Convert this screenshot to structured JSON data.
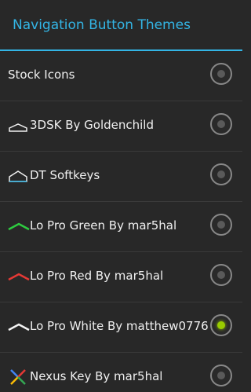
{
  "dialog": {
    "title": "Navigation Button Themes",
    "accent_color": "#33b5e5",
    "selected_color": "#99cc00"
  },
  "options": [
    {
      "label": "Stock Icons",
      "icon": "none",
      "selected": false
    },
    {
      "label": "3DSK By Goldenchild",
      "icon": "home-outline-icon",
      "selected": false
    },
    {
      "label": "DT Softkeys",
      "icon": "home-outline-blue-icon",
      "selected": false
    },
    {
      "label": "Lo Pro Green By mar5hal",
      "icon": "chevron-green-icon",
      "selected": false
    },
    {
      "label": "Lo Pro Red By mar5hal",
      "icon": "chevron-red-icon",
      "selected": false
    },
    {
      "label": "Lo Pro White By matthew0776",
      "icon": "chevron-white-icon",
      "selected": true
    },
    {
      "label": "Nexus Key By mar5hal",
      "icon": "nexus-x-icon",
      "selected": false
    }
  ]
}
